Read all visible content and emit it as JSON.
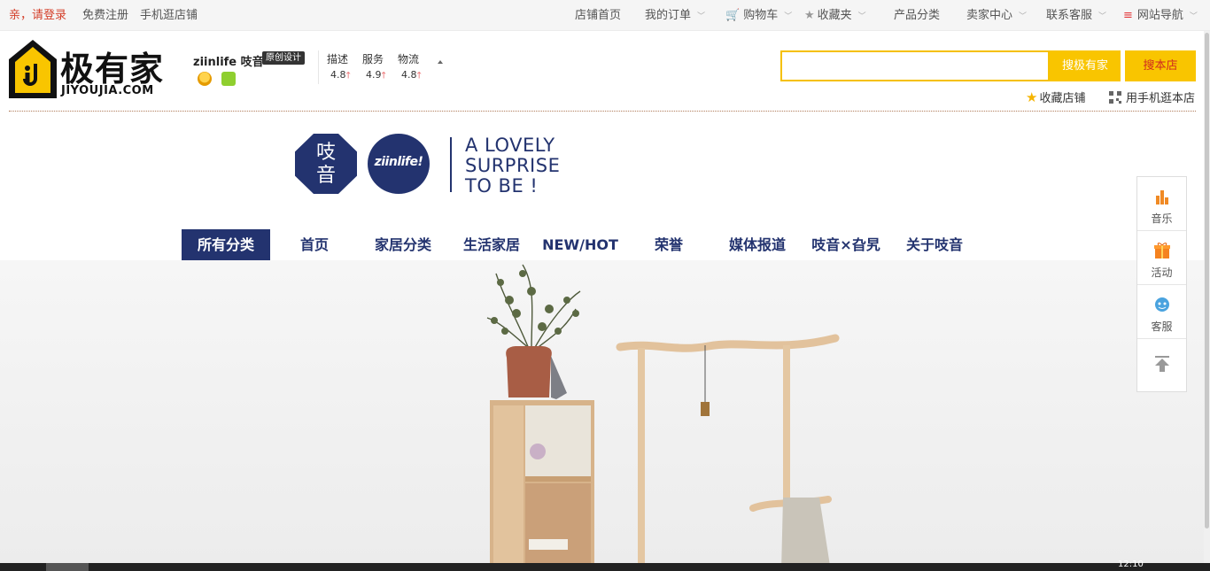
{
  "topbar": {
    "login": "亲，请登录",
    "register": "免费注册",
    "mobile": "手机逛店铺",
    "shop_home": "店铺首页",
    "my_orders": "我的订单",
    "cart": "购物车",
    "favorites": "收藏夹",
    "categories": "产品分类",
    "seller_center": "卖家中心",
    "contact": "联系客服",
    "site_nav": "网站导航"
  },
  "logo": {
    "cn": "极有家",
    "en": "JIYOUJIA.COM"
  },
  "shop": {
    "name": "ziinlife 吱音",
    "tag": "原创设计",
    "ratings": [
      {
        "label": "描述",
        "value": "4.8"
      },
      {
        "label": "服务",
        "value": "4.9"
      },
      {
        "label": "物流",
        "value": "4.8"
      }
    ]
  },
  "search": {
    "placeholder": "",
    "btn_all": "搜极有家",
    "btn_shop": "搜本店"
  },
  "header_links": {
    "fav_shop": "收藏店铺",
    "mobile_shop": "用手机逛本店"
  },
  "brand": {
    "badge_cn_1": "吱",
    "badge_cn_2": "音",
    "badge_en": "ziinlife!",
    "slogan": [
      "A LOVELY",
      "SURPRISE",
      "TO BE !"
    ]
  },
  "nav": [
    "所有分类",
    "首页",
    "家居分类",
    "生活家居",
    "NEW/HOT",
    "荣誉",
    "媒体报道",
    "吱音×旮旯",
    "关于吱音"
  ],
  "float_bar": {
    "music": "音乐",
    "activity": "活动",
    "service": "客服"
  },
  "hero_time": "12:10",
  "colors": {
    "brand_navy": "#23336f",
    "accent_yellow": "#f9c500",
    "login_red": "#d43f2a"
  }
}
